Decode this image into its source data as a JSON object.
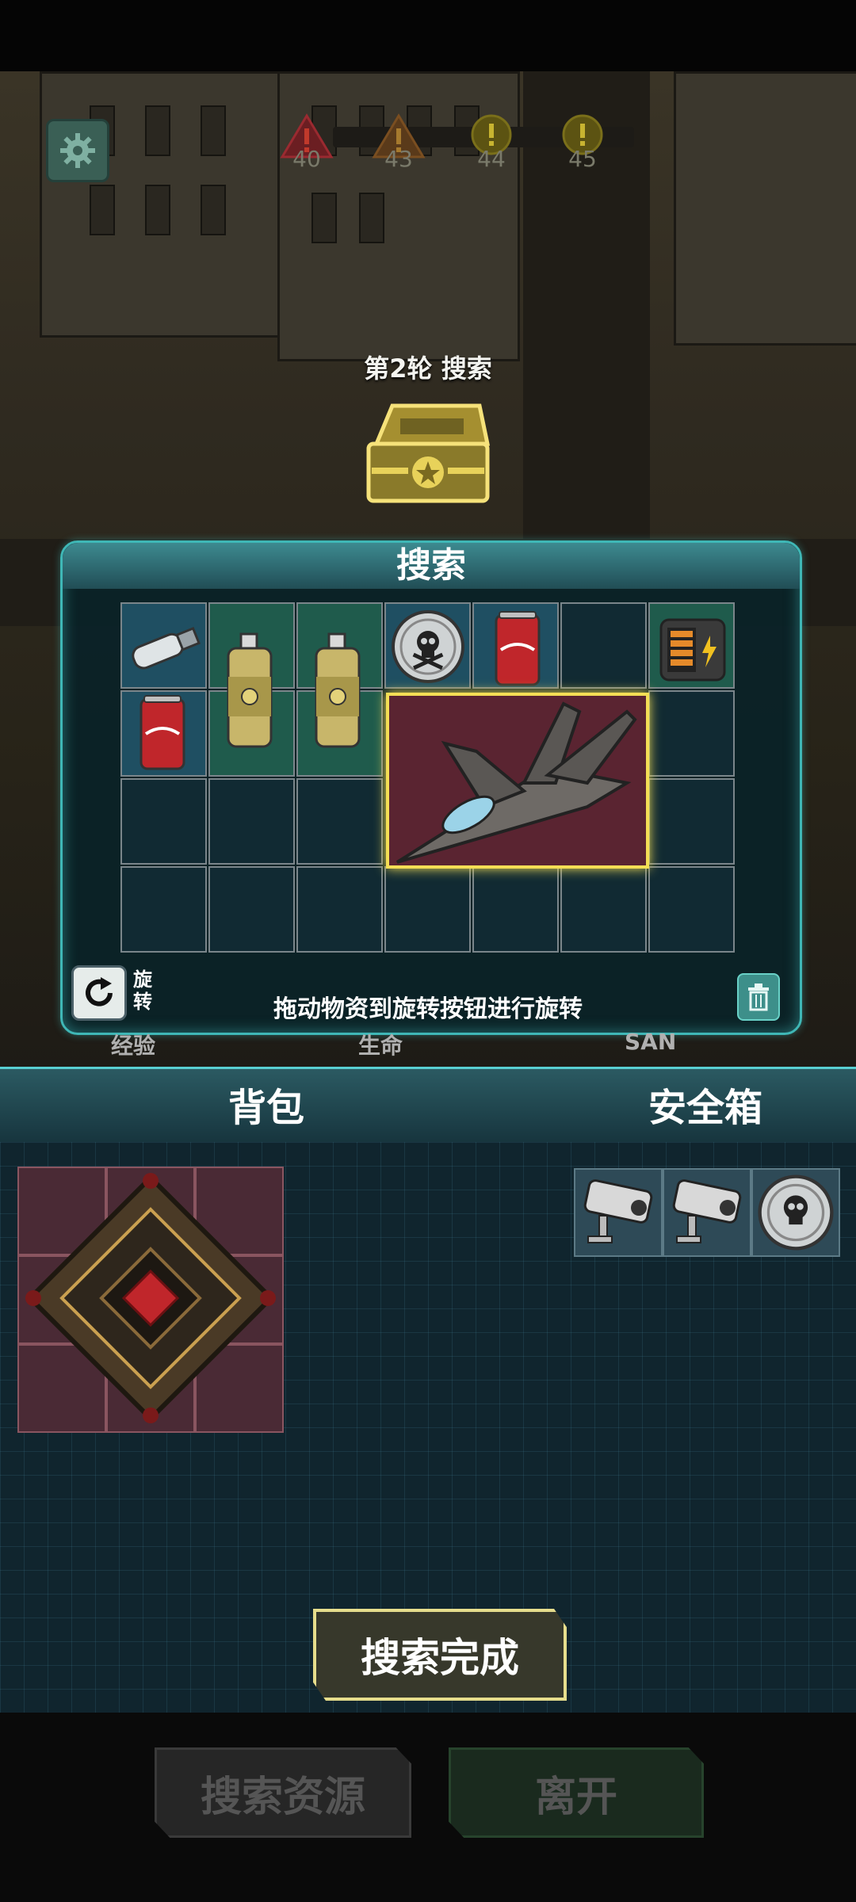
{
  "hud": {
    "waves": [
      {
        "number": "40",
        "type": "danger"
      },
      {
        "number": "43",
        "type": "danger"
      },
      {
        "number": "44",
        "type": "warning"
      },
      {
        "number": "45",
        "type": "warning"
      }
    ]
  },
  "round": {
    "title": "第2轮 搜索"
  },
  "search_panel": {
    "title": "搜索",
    "rotate_label": "旋转",
    "hint": "拖动物资到旋转按钮进行旋转",
    "items": [
      {
        "name": "usb-drive-icon"
      },
      {
        "name": "spray-can-icon"
      },
      {
        "name": "spray-can-icon"
      },
      {
        "name": "skull-coin-icon"
      },
      {
        "name": "cola-can-icon"
      },
      {
        "name": "battery-box-icon"
      },
      {
        "name": "cola-can-icon"
      },
      {
        "name": "fighter-jet-icon"
      }
    ]
  },
  "stats": {
    "labels": [
      "经验",
      "生命",
      "SAN"
    ]
  },
  "inventory": {
    "backpack_title": "背包",
    "safe_title": "安全箱",
    "backpack_items": [
      {
        "name": "circuit-core-icon"
      }
    ],
    "safe_items": [
      {
        "name": "camera-icon"
      },
      {
        "name": "camera-icon"
      },
      {
        "name": "skull-coin-icon"
      }
    ]
  },
  "actions": {
    "done": "搜索完成",
    "search_resources": "搜索资源",
    "leave": "离开"
  },
  "colors": {
    "accent_cyan": "#3fb7b6",
    "highlight_yellow": "#f4de55",
    "danger_red": "#b8323a"
  }
}
